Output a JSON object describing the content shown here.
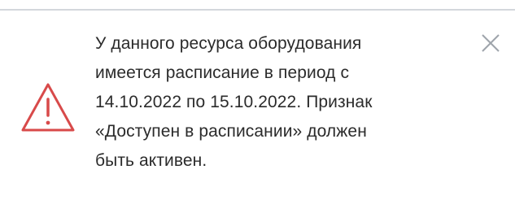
{
  "notification": {
    "type": "warning",
    "message_lines": [
      "У данного ресурса оборудования",
      "имеется расписание в период с",
      "14.10.2022 по 15.10.2022. Признак",
      "«Доступен в расписании» должен",
      "быть активен."
    ],
    "icons": {
      "status": "warning-triangle-icon",
      "close": "close-icon"
    },
    "colors": {
      "warning": "#d84a4a",
      "text": "#2b2b2b",
      "close": "#9ea4ab",
      "divider": "#d3d7dc"
    }
  }
}
